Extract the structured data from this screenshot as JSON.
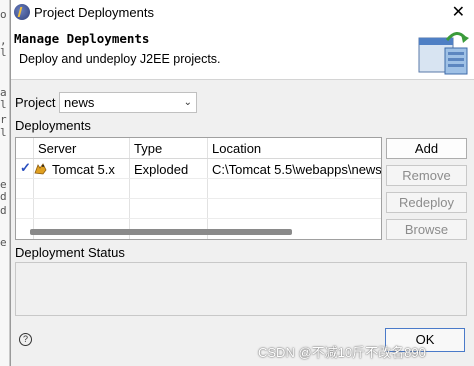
{
  "window": {
    "title": "Project Deployments",
    "close_glyph": "✕"
  },
  "banner": {
    "heading": "Manage Deployments",
    "description": "Deploy and undeploy J2EE projects."
  },
  "project": {
    "label": "Project",
    "value": "news"
  },
  "deployments": {
    "label": "Deployments",
    "columns": [
      "Server",
      "Type",
      "Location"
    ],
    "rows": [
      {
        "checked": true,
        "server": "Tomcat  5.x",
        "type": "Exploded",
        "location": "C:\\Tomcat 5.5\\webapps\\news"
      }
    ]
  },
  "buttons": {
    "add": "Add",
    "remove": "Remove",
    "redeploy": "Redeploy",
    "browse": "Browse"
  },
  "status": {
    "label": "Deployment Status"
  },
  "footer": {
    "ok": "OK",
    "help_glyph": "?"
  },
  "watermark": "CSDN @不减10斤不改名890",
  "icons": {
    "app": "eclipse-icon",
    "wizard": "deploy-wizard-icon",
    "server": "tomcat-icon",
    "check": "checkmark-icon"
  }
}
